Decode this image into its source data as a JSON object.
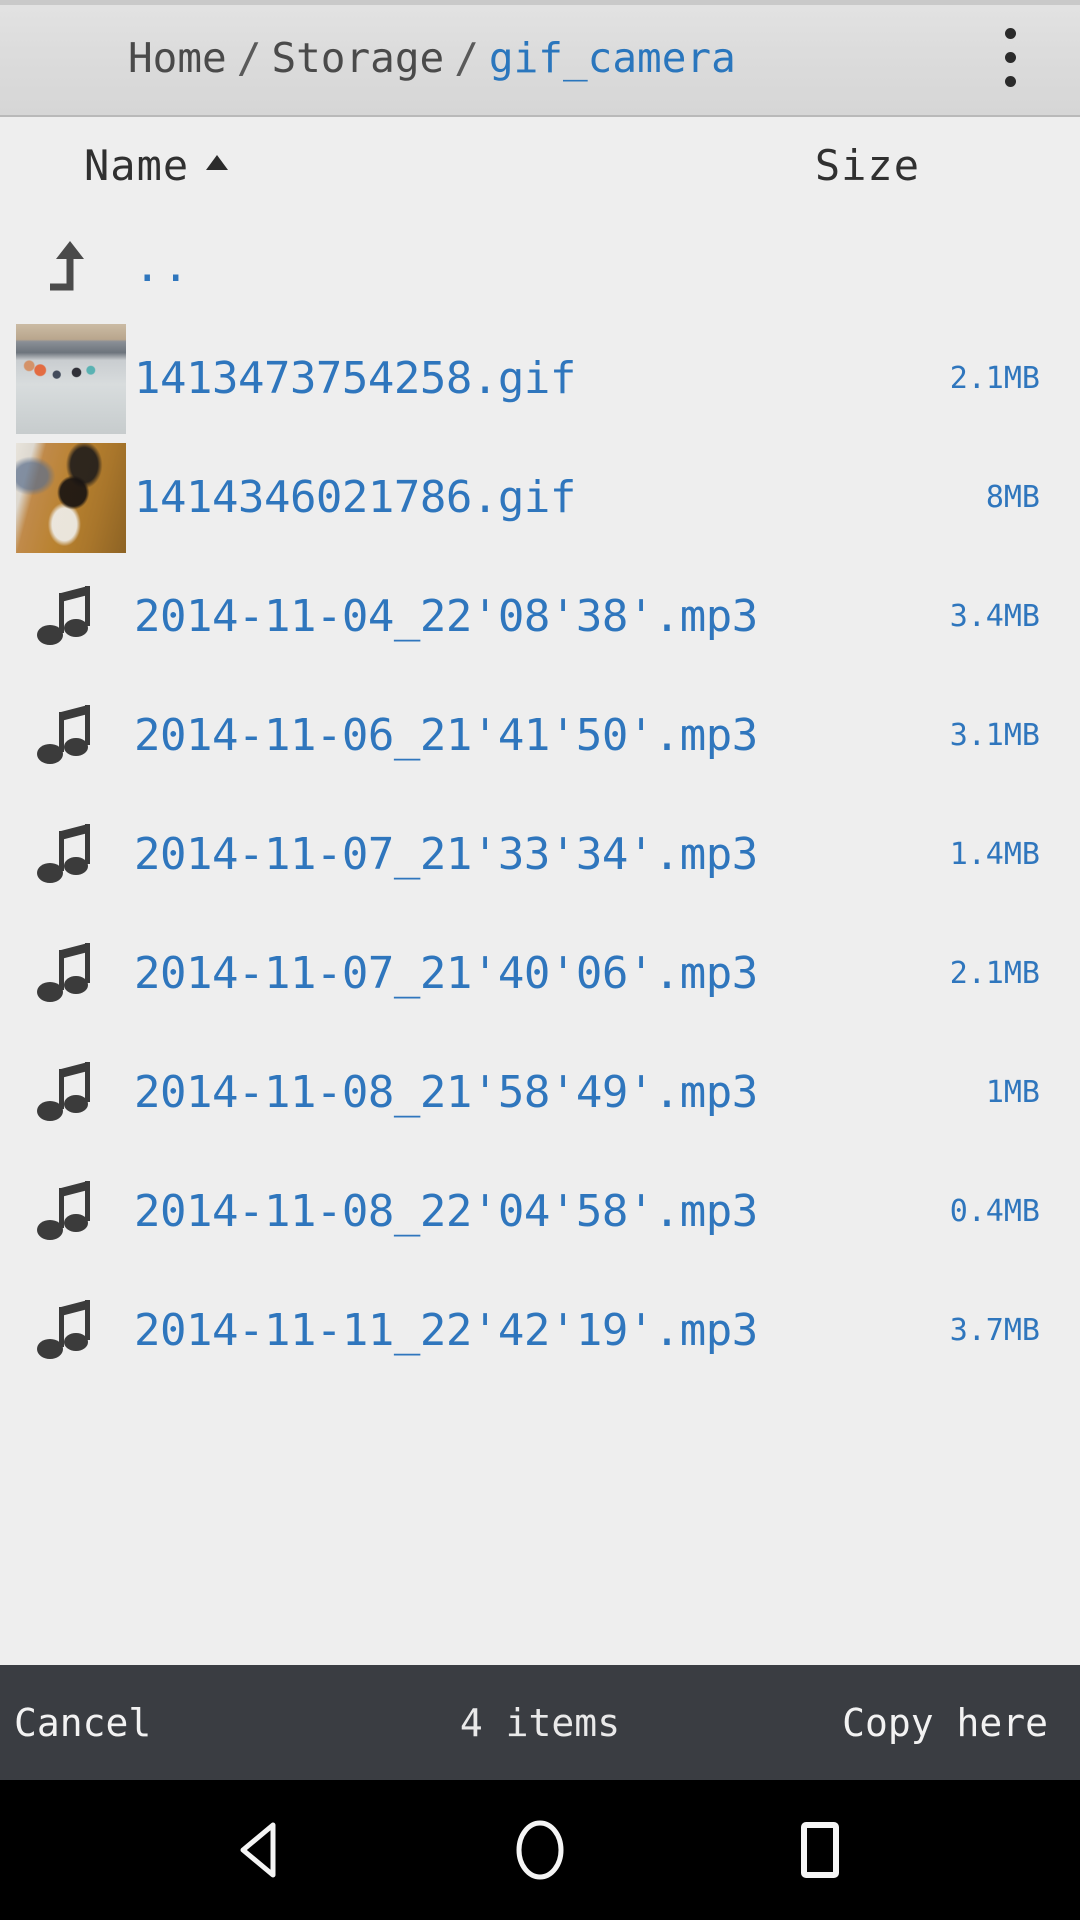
{
  "topbar": {
    "breadcrumb": [
      {
        "label": "Home",
        "current": false
      },
      {
        "label": "Storage",
        "current": false
      },
      {
        "label": "gif_camera",
        "current": true
      }
    ],
    "separator": "/",
    "overflow_icon": "overflow-menu-icon"
  },
  "columns": {
    "name_label": "Name",
    "sort_indicator": "ascending",
    "size_label": "Size"
  },
  "parent_entry": {
    "icon": "arrow-up-parent-icon",
    "label": ".."
  },
  "files": [
    {
      "name": "1413473754258.gif",
      "size": "2.1MB",
      "icon": "image-thumbnail",
      "thumb": "t1"
    },
    {
      "name": "1414346021786.gif",
      "size": "8MB",
      "icon": "image-thumbnail",
      "thumb": "t2"
    },
    {
      "name": "2014-11-04_22'08'38'.mp3",
      "size": "3.4MB",
      "icon": "music-note-icon"
    },
    {
      "name": "2014-11-06_21'41'50'.mp3",
      "size": "3.1MB",
      "icon": "music-note-icon"
    },
    {
      "name": "2014-11-07_21'33'34'.mp3",
      "size": "1.4MB",
      "icon": "music-note-icon"
    },
    {
      "name": "2014-11-07_21'40'06'.mp3",
      "size": "2.1MB",
      "icon": "music-note-icon"
    },
    {
      "name": "2014-11-08_21'58'49'.mp3",
      "size": "1MB",
      "icon": "music-note-icon"
    },
    {
      "name": "2014-11-08_22'04'58'.mp3",
      "size": "0.4MB",
      "icon": "music-note-icon"
    },
    {
      "name": "2014-11-11_22'42'19'.mp3",
      "size": "3.7MB",
      "icon": "music-note-icon"
    }
  ],
  "actionbar": {
    "cancel_label": "Cancel",
    "count_label": "4 items",
    "copy_label": "Copy here"
  },
  "navbar": {
    "back": "back-triangle-icon",
    "home": "home-circle-icon",
    "recents": "recents-square-icon"
  },
  "colors": {
    "link_blue": "#2f76bd",
    "topbar_bg": "#dcdcdc",
    "list_bg": "#eeeeee",
    "actionbar_bg": "#3a3d42",
    "navbar_bg": "#000000"
  }
}
